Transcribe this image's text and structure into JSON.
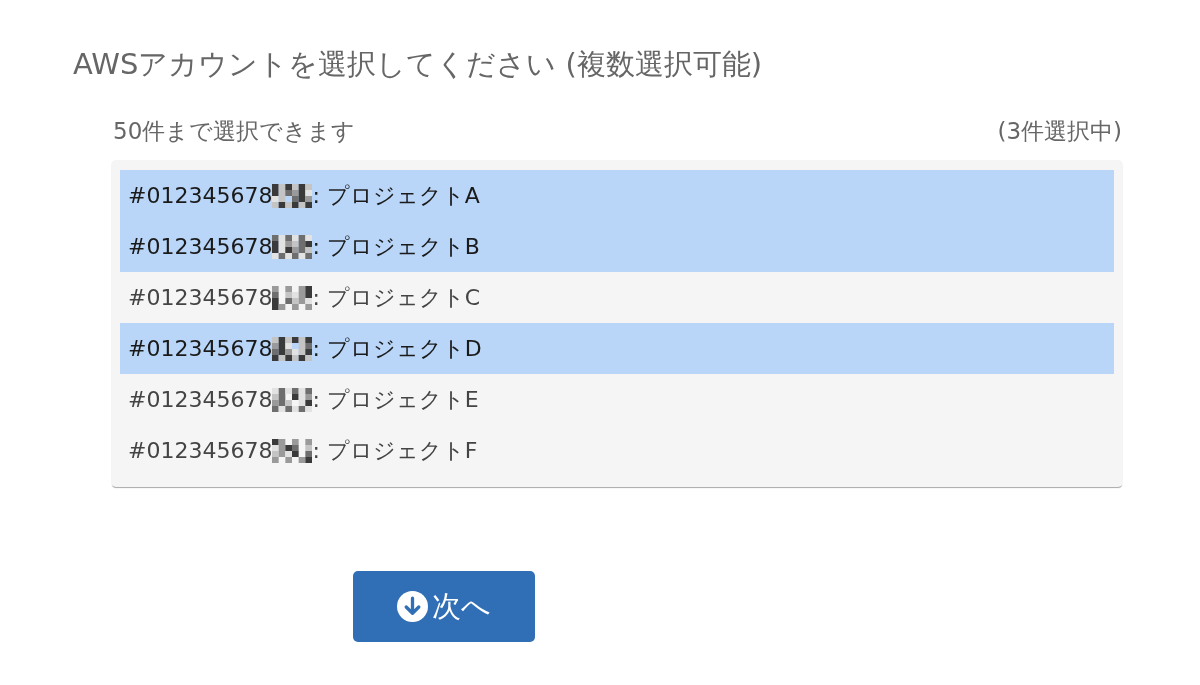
{
  "heading": "AWSアカウントを選択してください (複数選択可能)",
  "limit_note": "50件まで選択できます",
  "selected_count": "(3件選択中)",
  "accounts": [
    {
      "id": "#012345678",
      "redacted": true,
      "name": ": プロジェクトA",
      "selected": true
    },
    {
      "id": "#012345678",
      "redacted": true,
      "name": ": プロジェクトB",
      "selected": true
    },
    {
      "id": "#012345678",
      "redacted": true,
      "name": ": プロジェクトC",
      "selected": false
    },
    {
      "id": "#012345678",
      "redacted": true,
      "name": ": プロジェクトD",
      "selected": true
    },
    {
      "id": "#012345678",
      "redacted": true,
      "name": ": プロジェクトE",
      "selected": false
    },
    {
      "id": "#012345678",
      "redacted": true,
      "name": ": プロジェクトF",
      "selected": false
    }
  ],
  "next_button": {
    "label": "次へ"
  }
}
